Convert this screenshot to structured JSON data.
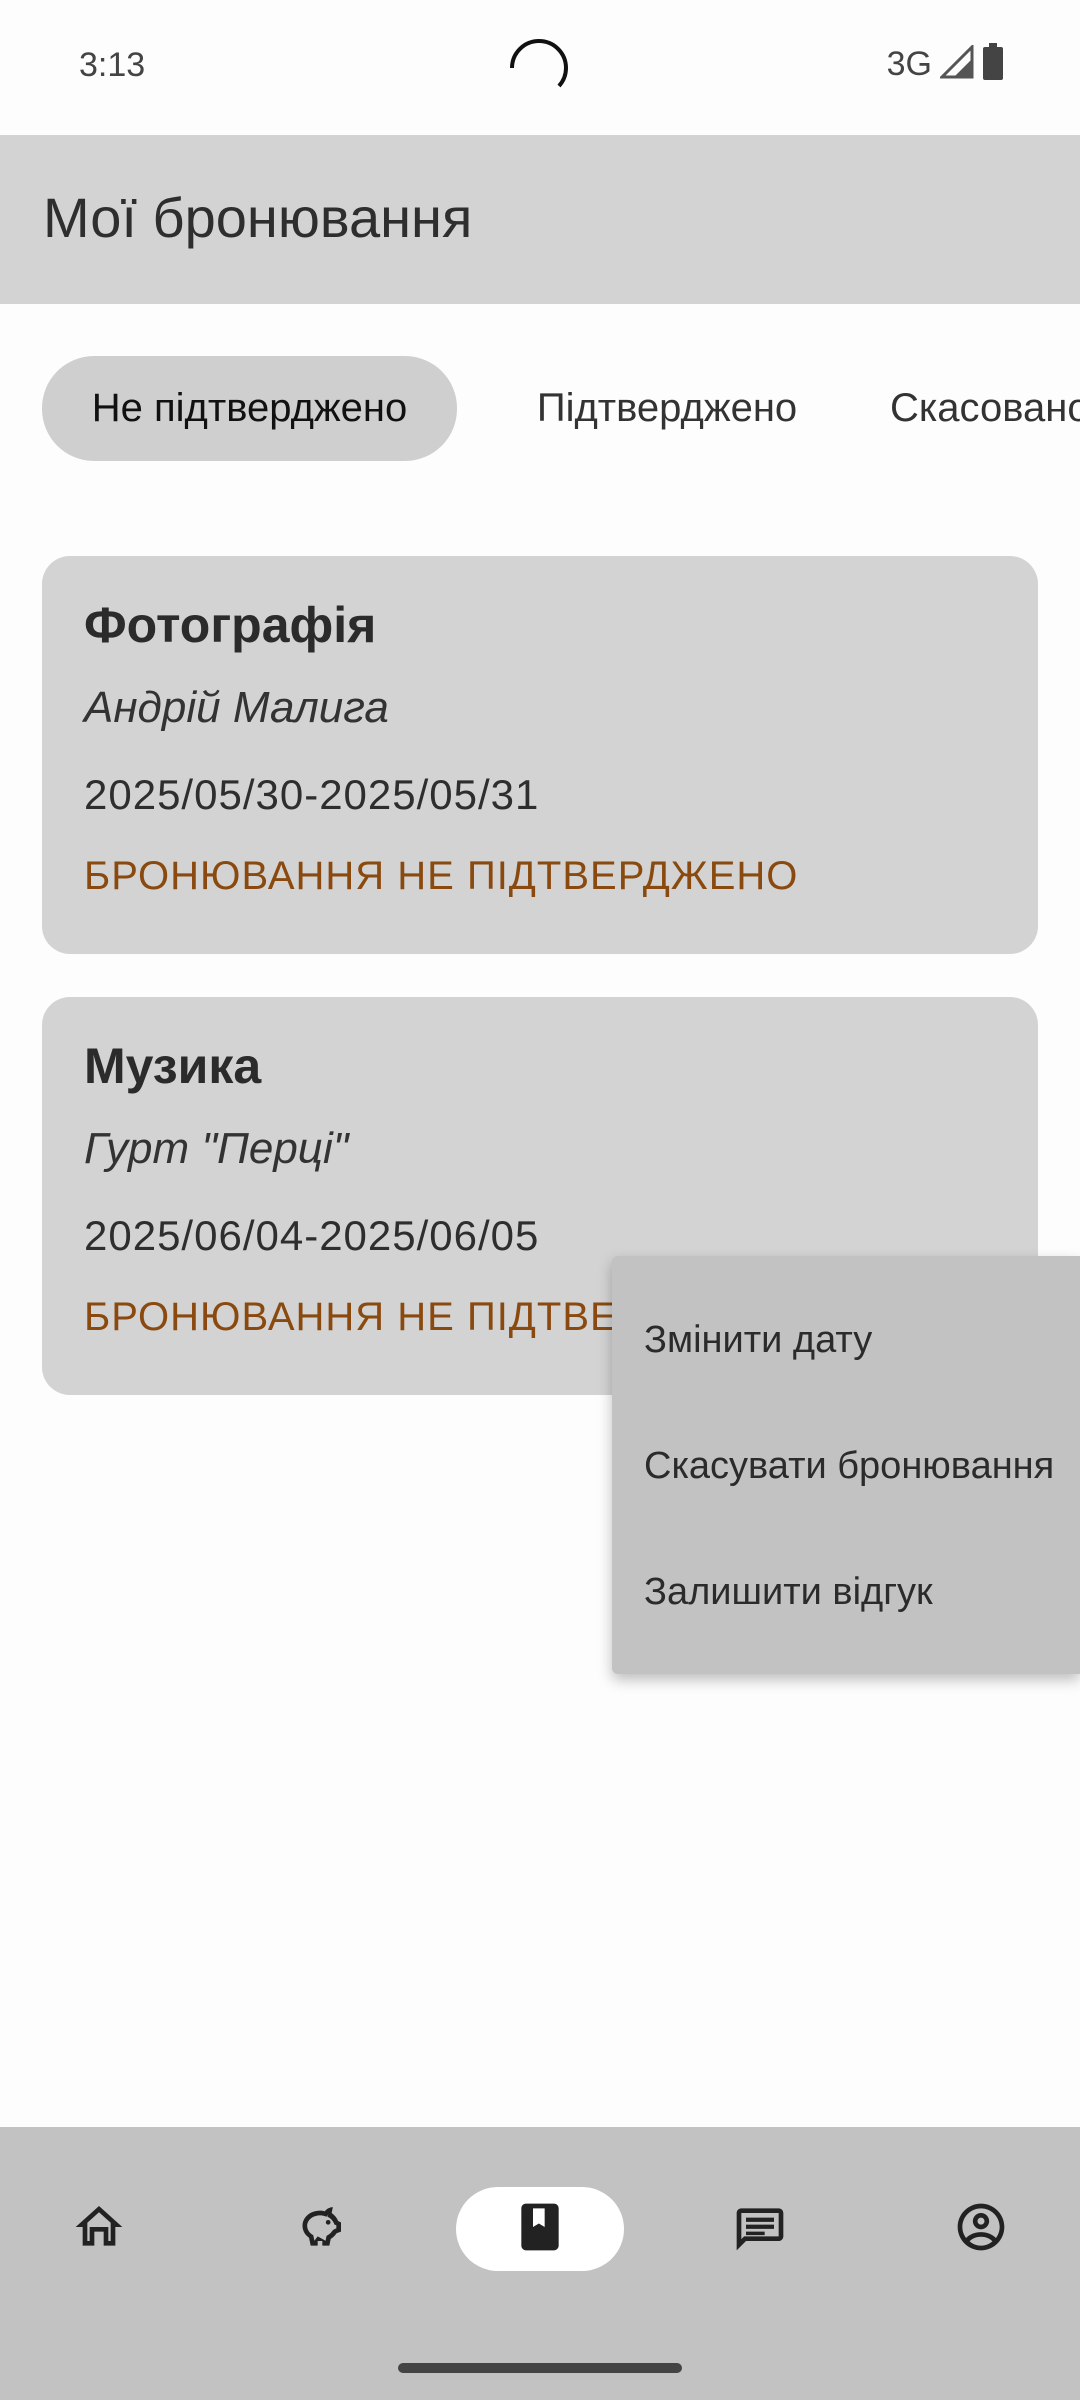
{
  "status_bar": {
    "time": "3:13",
    "network": "3G",
    "icons": [
      "camera-cutout",
      "signal-icon",
      "battery-icon"
    ]
  },
  "app_bar": {
    "title": "Мої бронювання"
  },
  "tabs": [
    {
      "label": "Не підтверджено",
      "active": true
    },
    {
      "label": "Підтверджено",
      "active": false
    },
    {
      "label": "Скасовано",
      "active": false
    }
  ],
  "bookings": [
    {
      "category": "Фотографія",
      "provider": "Андрій Малига",
      "dates": "2025/05/30-2025/05/31",
      "status": "БРОНЮВАННЯ НЕ ПІДТВЕРДЖЕНО"
    },
    {
      "category": "Музика",
      "provider": "Гурт \"Перці\"",
      "dates": "2025/06/04-2025/06/05",
      "status": "БРОНЮВАННЯ НЕ ПІДТВЕРДЖЕНО"
    }
  ],
  "popup_menu": {
    "items": [
      "Змінити дату",
      "Скасувати бронювання",
      "Залишити відгук"
    ]
  },
  "bottom_nav": {
    "items": [
      {
        "icon": "home-icon",
        "active": false
      },
      {
        "icon": "piggy-bank-icon",
        "active": false
      },
      {
        "icon": "bookmark-book-icon",
        "active": true
      },
      {
        "icon": "chat-icon",
        "active": false
      },
      {
        "icon": "account-circle-icon",
        "active": false
      }
    ]
  },
  "colors": {
    "status_text": "#8a4a0f",
    "card_bg": "#d3d3d3",
    "nav_bg": "#c2c2c2",
    "menu_bg": "#c2c2c2"
  }
}
